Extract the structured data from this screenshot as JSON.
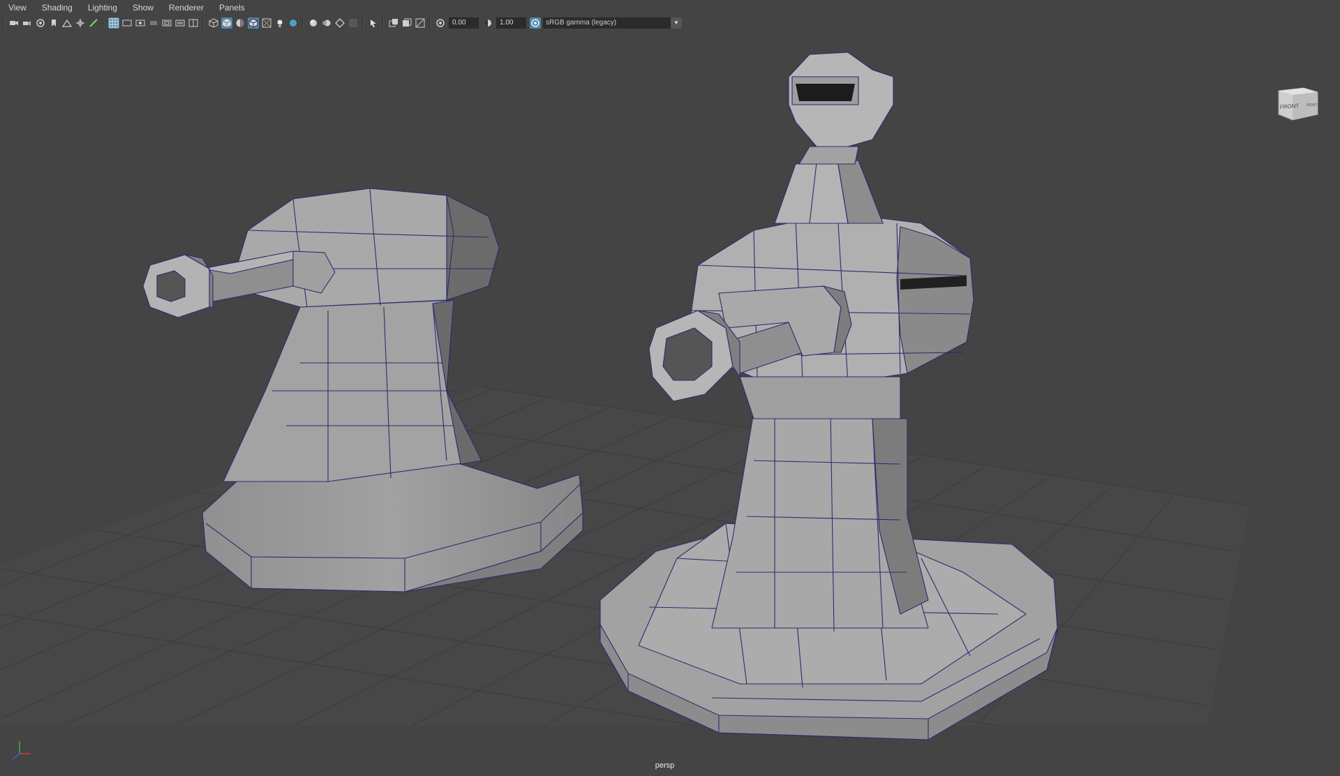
{
  "menubar": {
    "items": [
      {
        "label": "View"
      },
      {
        "label": "Shading"
      },
      {
        "label": "Lighting"
      },
      {
        "label": "Show"
      },
      {
        "label": "Renderer"
      },
      {
        "label": "Panels"
      }
    ]
  },
  "toolbar": {
    "exposure_value": "0.00",
    "gamma_value": "1.00",
    "color_space": "sRGB gamma (legacy)",
    "accent_color": "#5285a6"
  },
  "viewport": {
    "camera_label": "persp",
    "view_cube": {
      "front_label": "FRONT",
      "right_label": "RIGHT"
    },
    "background_color": "#444444",
    "grid_color": "#3c3c3c",
    "wireframe_color": "#2b2c6e"
  }
}
